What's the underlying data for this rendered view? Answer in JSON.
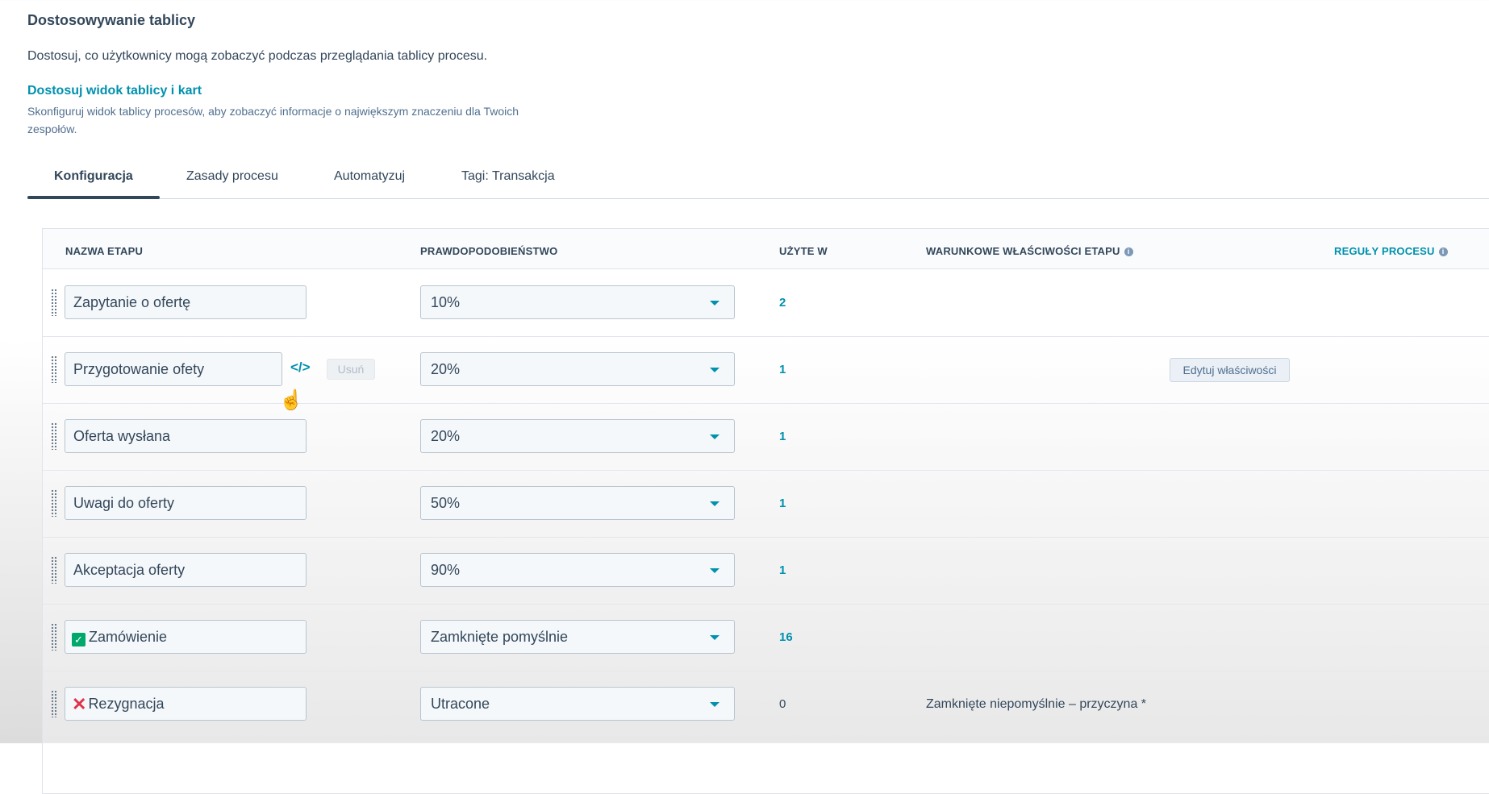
{
  "header": {
    "title": "Dostosowywanie tablicy",
    "description": "Dostosuj, co użytkownicy mogą zobaczyć podczas przeglądania tablicy procesu.",
    "link_title": "Dostosuj widok tablicy i kart",
    "link_description": "Skonfiguruj widok tablicy procesów, aby zobaczyć informacje o największym znaczeniu dla Twoich zespołów."
  },
  "tabs": [
    {
      "label": "Konfiguracja",
      "active": true
    },
    {
      "label": "Zasady procesu",
      "active": false
    },
    {
      "label": "Automatyzuj",
      "active": false
    },
    {
      "label": "Tagi: Transakcja",
      "active": false
    }
  ],
  "table": {
    "headers": {
      "stage_name": "NAZWA ETAPU",
      "probability": "PRAWDOPODOBIEŃSTWO",
      "used_in": "UŻYTE W",
      "conditional": "WARUNKOWE WŁAŚCIWOŚCI ETAPU",
      "rules": "REGUŁY PROCESU"
    },
    "rows": [
      {
        "name": "Zapytanie o ofertę",
        "probability": "10%",
        "used_in": "2"
      },
      {
        "name": "Przygotowanie ofety",
        "probability": "20%",
        "used_in": "1",
        "delete_label": "Usuń",
        "edit_label": "Edytuj właściwości"
      },
      {
        "name": "Oferta wysłana",
        "probability": "20%",
        "used_in": "1"
      },
      {
        "name": "Uwagi do oferty",
        "probability": "50%",
        "used_in": "1"
      },
      {
        "name": "Akceptacja oferty",
        "probability": "90%",
        "used_in": "1"
      },
      {
        "name": "Zamówienie",
        "probability": "Zamknięte pomyślnie",
        "used_in": "16",
        "icon": "check-icon"
      },
      {
        "name": "Rezygnacja",
        "probability": "Utracone",
        "used_in": "0",
        "icon": "x-icon",
        "conditional": "Zamknięte niepomyślnie – przyczyna *"
      }
    ]
  },
  "colors": {
    "accent": "#0091ae",
    "text": "#33475b",
    "success": "#00a86b",
    "danger": "#e0334b"
  }
}
